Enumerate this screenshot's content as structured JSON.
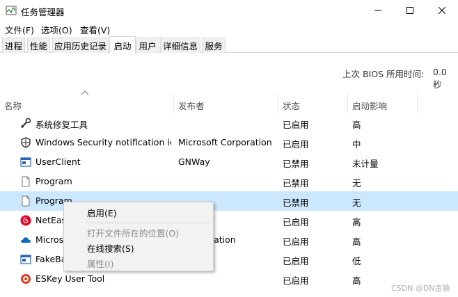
{
  "window": {
    "title": "任务管理器",
    "minimize_icon": "minimize-icon",
    "maximize_icon": "maximize-icon",
    "close_icon": "close-icon"
  },
  "menu": [
    "文件(F)",
    "选项(O)",
    "查看(V)"
  ],
  "tabs": [
    {
      "label": "进程"
    },
    {
      "label": "性能"
    },
    {
      "label": "应用历史记录"
    },
    {
      "label": "启动",
      "active": true
    },
    {
      "label": "用户"
    },
    {
      "label": "详细信息"
    },
    {
      "label": "服务"
    }
  ],
  "bios": {
    "label": "上次 BIOS 所用时间:",
    "value": "0.0 秒"
  },
  "columns": [
    "名称",
    "发布者",
    "状态",
    "启动影响"
  ],
  "rows": [
    {
      "name": "系统修复工具",
      "publisher": "",
      "status": "已启用",
      "impact": "高",
      "icon": "repair-tool-icon"
    },
    {
      "name": "Windows Security notification ic...",
      "publisher": "Microsoft Corporation",
      "status": "已启用",
      "impact": "中",
      "icon": "shield-icon"
    },
    {
      "name": "UserClient",
      "publisher": "GNWay",
      "status": "已禁用",
      "impact": "未计量",
      "icon": "app-window-icon"
    },
    {
      "name": "Program",
      "publisher": "",
      "status": "已禁用",
      "impact": "无",
      "icon": "file-icon"
    },
    {
      "name": "Program",
      "publisher": "",
      "status": "已禁用",
      "impact": "无",
      "icon": "file-icon",
      "selected": true
    },
    {
      "name": "NetEas",
      "publisher": "",
      "status": "已启用",
      "impact": "高",
      "icon": "netease-music-icon"
    },
    {
      "name": "Micros",
      "publisher": "t Corporation",
      "status": "已启用",
      "impact": "高",
      "icon": "cloud-icon"
    },
    {
      "name": "FakeBa",
      "publisher": "",
      "status": "已启用",
      "impact": "低",
      "icon": "app-window-icon"
    },
    {
      "name": "ESKey User Tool",
      "publisher": "",
      "status": "已启用",
      "impact": "高",
      "icon": "eskey-icon"
    }
  ],
  "context_menu": [
    {
      "label": "启用(E)",
      "disabled": false
    },
    {
      "label": "打开文件所在的位置(O)",
      "disabled": true
    },
    {
      "label": "在线搜索(S)",
      "disabled": false
    },
    {
      "label": "属性(I)",
      "disabled": true
    }
  ],
  "watermark": "CSDN @DN金猿"
}
